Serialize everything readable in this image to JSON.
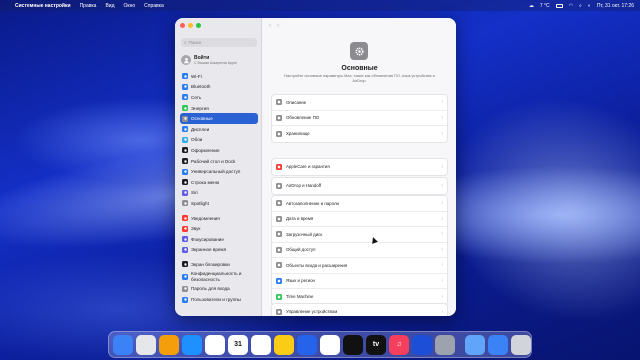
{
  "menubar": {
    "apple": "",
    "app": "Системные настройки",
    "items": [
      "Правка",
      "Вид",
      "Окно",
      "Справка"
    ],
    "weather": "7 °C",
    "datetime": "Пт, 31 окт. 17:26"
  },
  "window": {
    "search_placeholder": "Поиск",
    "account": {
      "title": "Войти",
      "subtitle": "С Вашим Аккаунтом Apple"
    },
    "sidebar": [
      {
        "label": "Wi-Fi",
        "color": "#2a7bf6",
        "icon": "wifi-icon"
      },
      {
        "label": "Bluetooth",
        "color": "#2a7bf6",
        "icon": "bluetooth-icon"
      },
      {
        "label": "Сеть",
        "color": "#2a7bf6",
        "icon": "globe-icon"
      },
      {
        "label": "Энергия",
        "color": "#34c759",
        "icon": "battery-icon"
      },
      {
        "label": "Основные",
        "color": "#8e8e93",
        "icon": "gear-icon",
        "active": true
      },
      {
        "label": "Дисплеи",
        "color": "#2a7bf6",
        "icon": "display-icon"
      },
      {
        "label": "Обои",
        "color": "#32ade6",
        "icon": "wallpaper-icon"
      },
      {
        "label": "Оформление",
        "color": "#1d1d1f",
        "icon": "appearance-icon"
      },
      {
        "label": "Рабочий стол и Dock",
        "color": "#1d1d1f",
        "icon": "dock-icon"
      },
      {
        "label": "Универсальный доступ",
        "color": "#2a7bf6",
        "icon": "accessibility-icon"
      },
      {
        "label": "Строка меню",
        "color": "#1d1d1f",
        "icon": "menubar-icon"
      },
      {
        "label": "Siri",
        "color": "#5e5ce6",
        "icon": "siri-icon"
      },
      {
        "label": "Spotlight",
        "color": "#8e8e93",
        "icon": "search-icon"
      },
      {
        "label": "Уведомления",
        "color": "#ff3b30",
        "icon": "bell-icon",
        "gap": true
      },
      {
        "label": "Звук",
        "color": "#ff3b30",
        "icon": "speaker-icon"
      },
      {
        "label": "Фокусирование",
        "color": "#5e5ce6",
        "icon": "moon-icon"
      },
      {
        "label": "Экранное время",
        "color": "#5e5ce6",
        "icon": "hourglass-icon"
      },
      {
        "label": "Экран блокировки",
        "color": "#1d1d1f",
        "icon": "lock-screen-icon",
        "gap": true
      },
      {
        "label": "Конфиденциальность и безопасность",
        "color": "#2a7bf6",
        "icon": "hand-icon",
        "double": true
      },
      {
        "label": "Пароль для входа",
        "color": "#8e8e93",
        "icon": "lock-icon"
      },
      {
        "label": "Пользователи и группы",
        "color": "#2a7bf6",
        "icon": "users-icon"
      }
    ],
    "main": {
      "title": "Основные",
      "description": "Настройте основные параметры Mac, такие как обновления ПО, язык устройства и AirDrop.",
      "groups": [
        [
          {
            "label": "Описание",
            "color": "#8e8e93",
            "icon": "info-icon"
          },
          {
            "label": "Обновление ПО",
            "color": "#8e8e93",
            "icon": "software-update-icon"
          },
          {
            "label": "Хранилище",
            "color": "#8e8e93",
            "icon": "storage-icon"
          }
        ],
        [
          {
            "label": "AppleCare и гарантия",
            "color": "#ff3b30",
            "icon": "applecare-icon"
          }
        ],
        [
          {
            "label": "AirDrop и Handoff",
            "color": "#8e8e93",
            "icon": "airdrop-icon"
          }
        ],
        [
          {
            "label": "Автозаполнение и пароли",
            "color": "#8e8e93",
            "icon": "autofill-icon"
          },
          {
            "label": "Дата и время",
            "color": "#8e8e93",
            "icon": "clock-icon"
          },
          {
            "label": "Загрузочный диск",
            "color": "#8e8e93",
            "icon": "disk-icon"
          },
          {
            "label": "Общий доступ",
            "color": "#8e8e93",
            "icon": "sharing-icon"
          },
          {
            "label": "Объекты входа и расширения",
            "color": "#8e8e93",
            "icon": "login-items-icon"
          },
          {
            "label": "Язык и регион",
            "color": "#2a7bf6",
            "icon": "language-icon"
          },
          {
            "label": "Time Machine",
            "color": "#34c759",
            "icon": "time-machine-icon"
          }
        ],
        [
          {
            "label": "Управление устройством",
            "color": "#8e8e93",
            "icon": "device-management-icon"
          }
        ],
        [
          {
            "label": "Перенос или сброс",
            "color": "#8e8e93",
            "icon": "reset-icon"
          }
        ]
      ]
    }
  },
  "dock": [
    {
      "name": "finder-icon",
      "color": "#3b82f6",
      "label": ""
    },
    {
      "name": "launchpad-icon",
      "color": "#e5e7eb",
      "label": ""
    },
    {
      "name": "calculator-icon",
      "color": "#f59e0b",
      "label": ""
    },
    {
      "name": "app-store-icon",
      "color": "#1e90ff",
      "label": ""
    },
    {
      "name": "photos-icon",
      "color": "#ffffff",
      "label": ""
    },
    {
      "name": "calendar-icon",
      "color": "#ffffff",
      "label": "31"
    },
    {
      "name": "reminders-icon",
      "color": "#ffffff",
      "label": ""
    },
    {
      "name": "notes-icon",
      "color": "#facc15",
      "label": ""
    },
    {
      "name": "keynote-icon",
      "color": "#2563eb",
      "label": ""
    },
    {
      "name": "preview-icon",
      "color": "#ffffff",
      "label": ""
    },
    {
      "name": "affinity-icon",
      "color": "#111111",
      "label": ""
    },
    {
      "name": "tv-icon",
      "color": "#111111",
      "label": "tv"
    },
    {
      "name": "music-icon",
      "color": "#f43f5e",
      "label": "♫"
    },
    {
      "name": "xcode-icon",
      "color": "#1d4ed8",
      "label": ""
    },
    {
      "name": "system-settings-icon",
      "color": "#9ca3af",
      "label": ""
    },
    {
      "name": "folder-icon",
      "color": "#60a5fa",
      "label": ""
    },
    {
      "name": "downloads-icon",
      "color": "#3b82f6",
      "label": ""
    },
    {
      "name": "trash-icon",
      "color": "#d1d5db",
      "label": ""
    }
  ]
}
